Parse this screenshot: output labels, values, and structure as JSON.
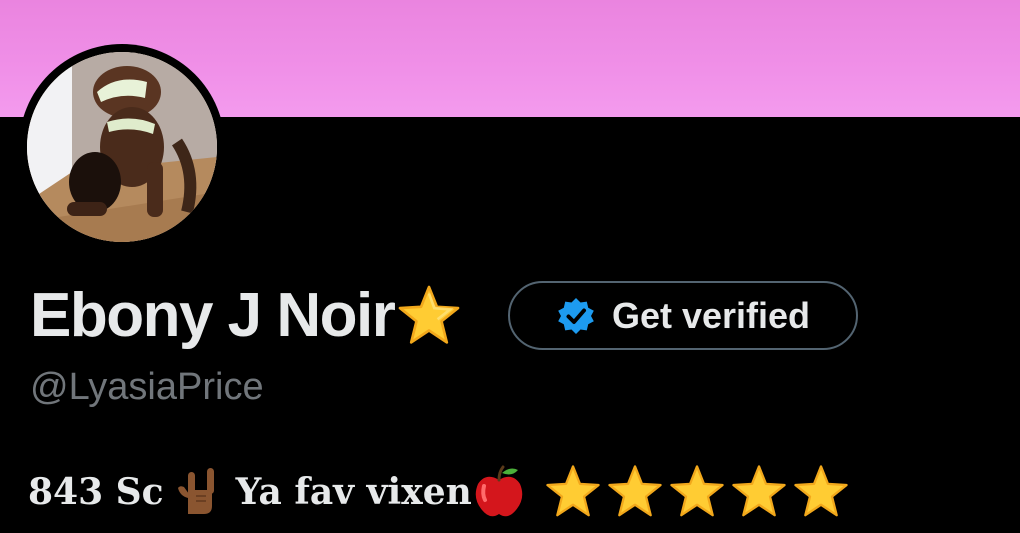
{
  "profile": {
    "display_name": "Ebony J Noir",
    "handle": "@LyasiaPrice",
    "banner_color": "#f090e8",
    "name_badge_icon": "star-emoji"
  },
  "verify_button": {
    "label": "Get verified",
    "icon": "verified-badge-icon",
    "icon_color": "#1d9bf0"
  },
  "bio": {
    "part1": "843 Sc",
    "emoji1": "love-you-gesture-emoji",
    "part2": "Ya fav vixen",
    "emoji2": "red-apple-emoji",
    "star_count": 5
  },
  "colors": {
    "background": "#000000",
    "primary_text": "#e7e9ea",
    "secondary_text": "#71767b",
    "button_border": "#536471"
  }
}
